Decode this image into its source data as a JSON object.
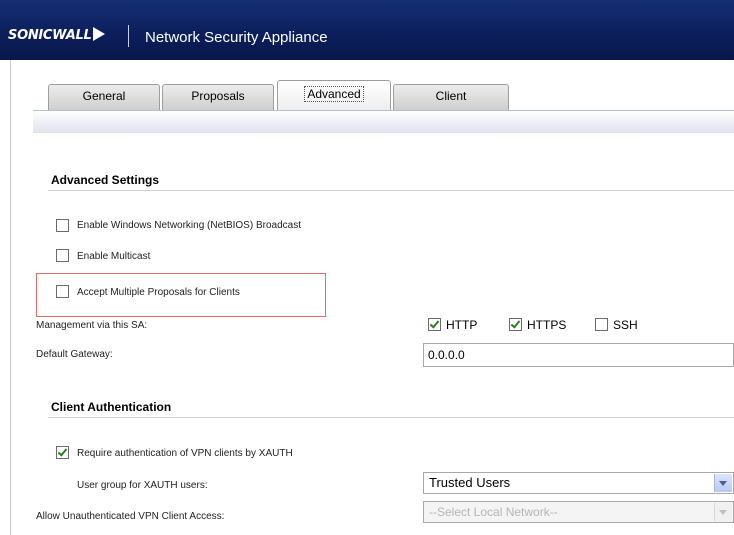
{
  "header": {
    "logo_text": "SONICWALL",
    "app_title": "Network Security Appliance",
    "bg_color": "#0c1f5c"
  },
  "tabs": [
    {
      "label": "General",
      "active": false
    },
    {
      "label": "Proposals",
      "active": false
    },
    {
      "label": "Advanced",
      "active": true
    },
    {
      "label": "Client",
      "active": false
    }
  ],
  "advanced_settings": {
    "title": "Advanced Settings",
    "options": [
      {
        "label": "Enable Windows Networking (NetBIOS) Broadcast",
        "checked": false
      },
      {
        "label": "Enable Multicast",
        "checked": false
      },
      {
        "label": "Accept Multiple Proposals for Clients",
        "checked": false
      }
    ],
    "management_label": "Management via this SA:",
    "management_options": [
      {
        "label": "HTTP",
        "checked": true
      },
      {
        "label": "HTTPS",
        "checked": true
      },
      {
        "label": "SSH",
        "checked": false
      }
    ],
    "default_gateway_label": "Default Gateway:",
    "default_gateway_value": "0.0.0.0"
  },
  "client_authentication": {
    "title": "Client Authentication",
    "require_xauth_label": "Require authentication of VPN clients by XAUTH",
    "require_xauth_checked": true,
    "user_group_label": "User group for XAUTH users:",
    "user_group_value": "Trusted Users",
    "unauth_access_label": "Allow Unauthenticated VPN Client Access:",
    "unauth_access_value": "--Select Local Network--"
  },
  "highlight_color": "#e56a6a"
}
